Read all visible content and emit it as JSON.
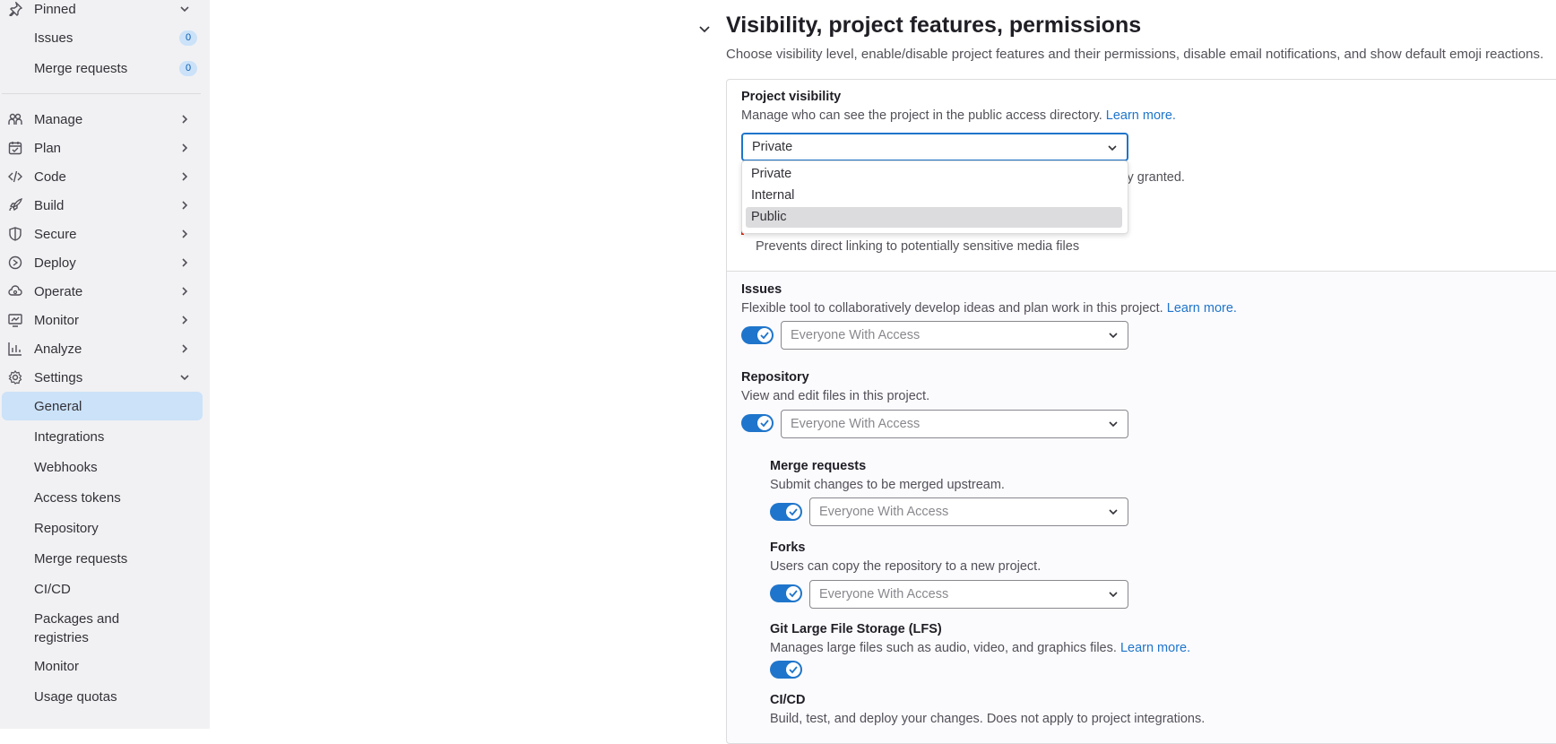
{
  "sidebar": {
    "pinned": {
      "label": "Pinned",
      "icon": "pin-icon"
    },
    "pinned_items": [
      {
        "label": "Issues",
        "count": "0"
      },
      {
        "label": "Merge requests",
        "count": "0"
      }
    ],
    "groups": [
      {
        "label": "Manage",
        "icon": "users-icon"
      },
      {
        "label": "Plan",
        "icon": "calendar-icon"
      },
      {
        "label": "Code",
        "icon": "code-icon"
      },
      {
        "label": "Build",
        "icon": "rocket-icon"
      },
      {
        "label": "Secure",
        "icon": "shield-icon"
      },
      {
        "label": "Deploy",
        "icon": "deploy-icon"
      },
      {
        "label": "Operate",
        "icon": "cloud-icon"
      },
      {
        "label": "Monitor",
        "icon": "monitor-icon"
      },
      {
        "label": "Analyze",
        "icon": "chart-icon"
      },
      {
        "label": "Settings",
        "icon": "gear-icon"
      }
    ],
    "settings_items": [
      {
        "label": "General",
        "active": true
      },
      {
        "label": "Integrations"
      },
      {
        "label": "Webhooks"
      },
      {
        "label": "Access tokens"
      },
      {
        "label": "Repository"
      },
      {
        "label": "Merge requests"
      },
      {
        "label": "CI/CD"
      },
      {
        "label": "Packages and registries"
      },
      {
        "label": "Monitor"
      },
      {
        "label": "Usage quotas"
      }
    ]
  },
  "section": {
    "title": "Visibility, project features, permissions",
    "description": "Choose visibility level, enable/disable project features and their permissions, disable email notifications, and show default emoji reactions."
  },
  "visibility": {
    "label": "Project visibility",
    "help": "Manage who can see the project in the public access directory.",
    "learn_more": "Learn more.",
    "selected": "Private",
    "options": [
      "Private",
      "Internal",
      "Public"
    ],
    "highlighted": "Public",
    "hidden_help_tail": "itly granted.",
    "media_help": "Prevents direct linking to potentially sensitive media files"
  },
  "features": {
    "issues": {
      "label": "Issues",
      "help": "Flexible tool to collaboratively develop ideas and plan work in this project.",
      "learn_more": "Learn more.",
      "access": "Everyone With Access",
      "enabled": true
    },
    "repository": {
      "label": "Repository",
      "help": "View and edit files in this project.",
      "access": "Everyone With Access",
      "enabled": true
    },
    "merge_requests": {
      "label": "Merge requests",
      "help": "Submit changes to be merged upstream.",
      "access": "Everyone With Access",
      "enabled": true
    },
    "forks": {
      "label": "Forks",
      "help": "Users can copy the repository to a new project.",
      "access": "Everyone With Access",
      "enabled": true
    },
    "lfs": {
      "label": "Git Large File Storage (LFS)",
      "help": "Manages large files such as audio, video, and graphics files.",
      "learn_more": "Learn more.",
      "enabled": true
    },
    "cicd": {
      "label": "CI/CD",
      "help": "Build, test, and deploy your changes. Does not apply to project integrations."
    }
  },
  "colors": {
    "accent": "#1f75cb",
    "active_nav": "#cbe2f9",
    "sidebar_bg": "#f1f1f3"
  }
}
